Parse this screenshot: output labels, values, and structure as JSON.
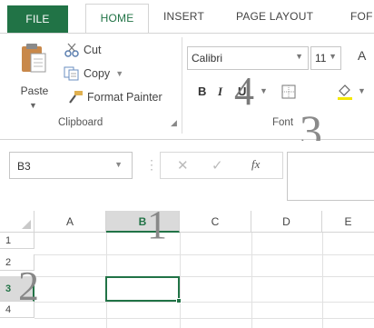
{
  "tabs": {
    "file": "FILE",
    "home": "HOME",
    "insert": "INSERT",
    "page_layout": "PAGE LAYOUT",
    "formulas": "FOF"
  },
  "clipboard": {
    "paste": "Paste",
    "cut": "Cut",
    "copy": "Copy",
    "format_painter": "Format Painter",
    "group_label": "Clipboard"
  },
  "font": {
    "name": "Calibri",
    "size": "11",
    "bold": "B",
    "italic": "I",
    "underline": "U",
    "grow": "A",
    "group_label": "Font"
  },
  "formula_bar": {
    "name_box": "B3",
    "fx": "fx",
    "value": ""
  },
  "grid": {
    "columns": [
      "A",
      "B",
      "C",
      "D",
      "E"
    ],
    "rows": [
      "1",
      "2",
      "3",
      "4"
    ],
    "selected_column": "B",
    "selected_row": "3",
    "active_cell": "B3"
  },
  "annotations": {
    "one": "1",
    "two": "2",
    "three": "3",
    "four": "4"
  },
  "colors": {
    "accent": "#217346",
    "header_selected": "#dadada"
  },
  "icons": [
    "paste-icon",
    "scissors-icon",
    "copy-icon",
    "format-painter-icon",
    "borders-icon",
    "fill-color-icon",
    "cancel-icon",
    "enter-icon",
    "insert-function-icon",
    "select-all-icon",
    "dialog-launcher-icon"
  ]
}
